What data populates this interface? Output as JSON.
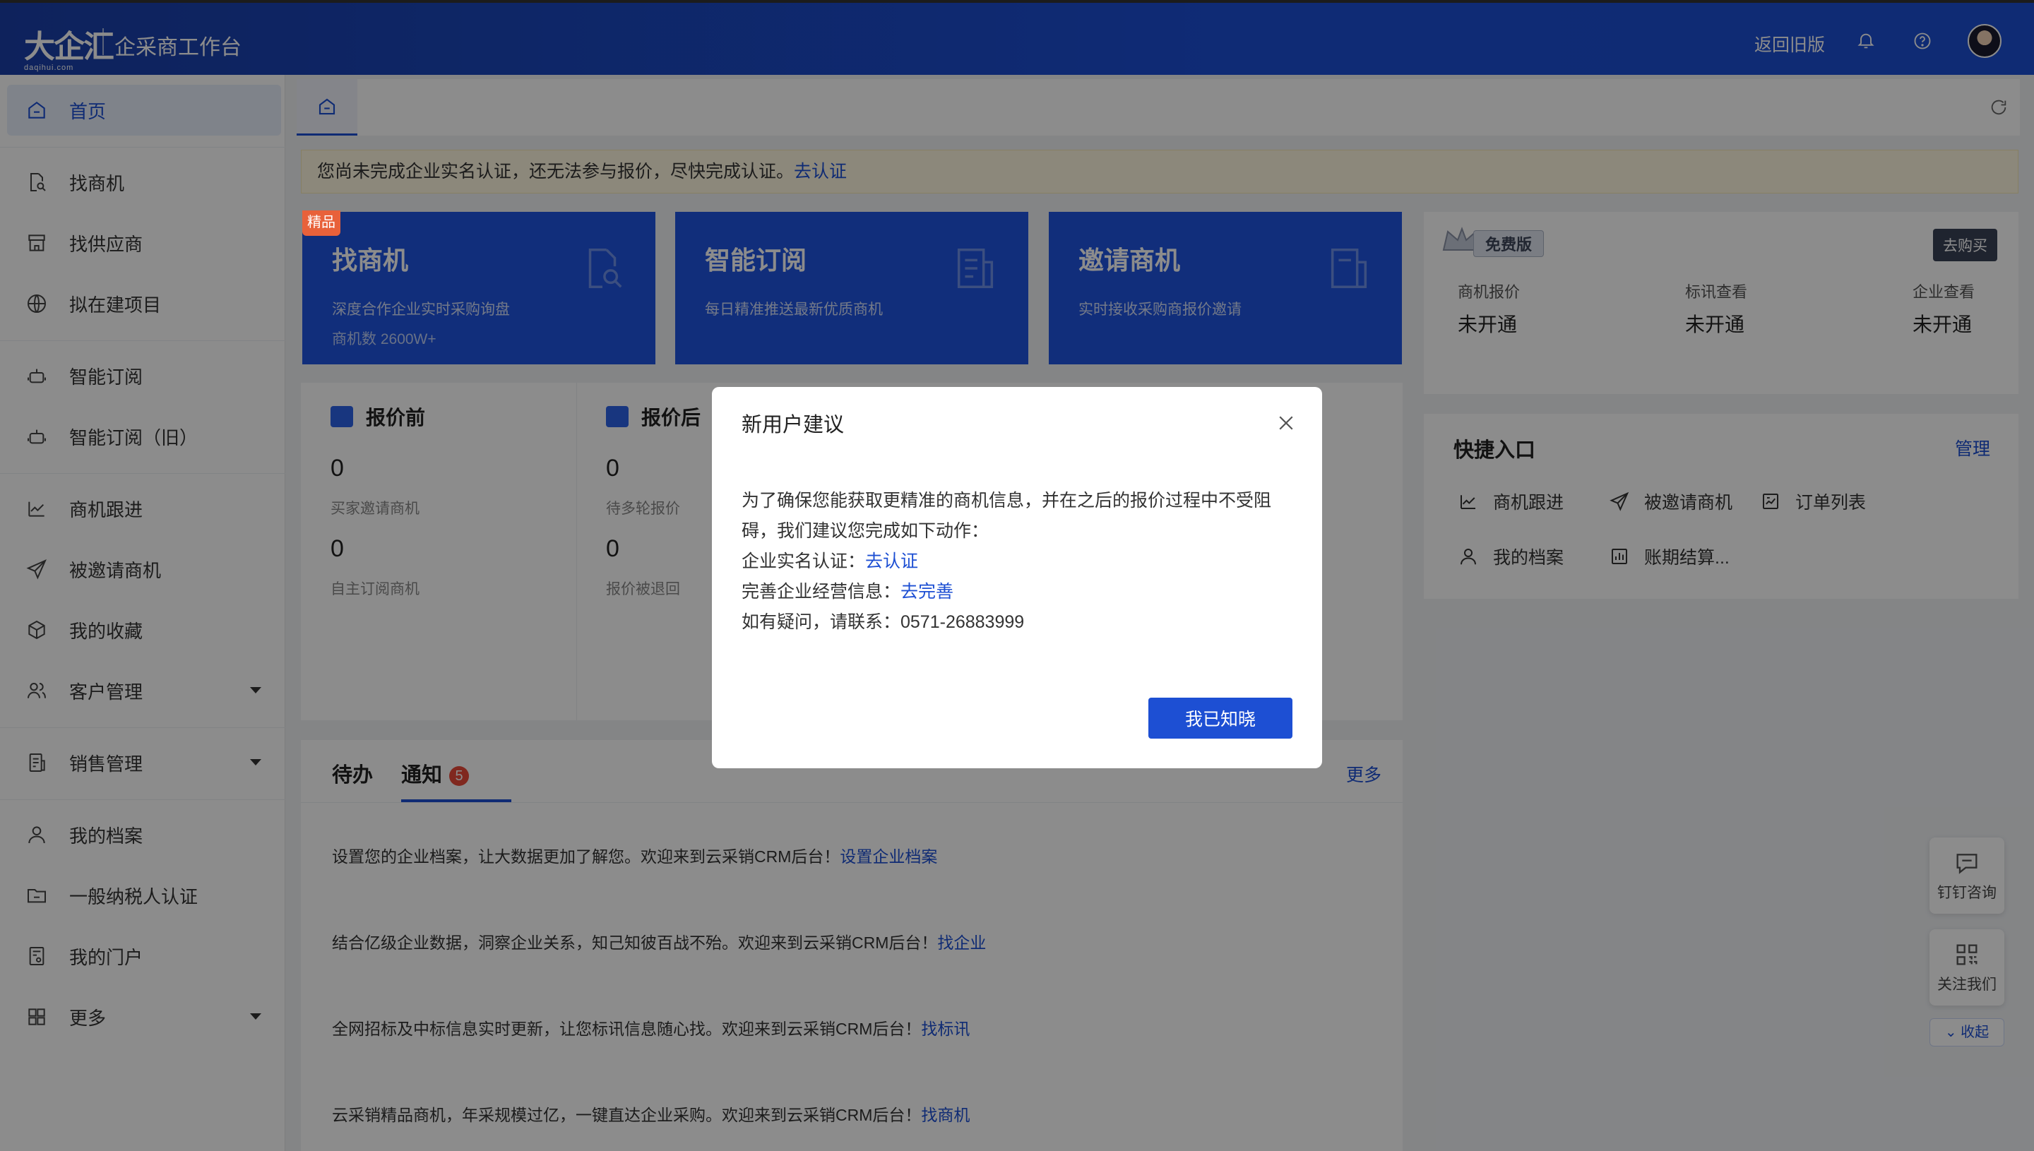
{
  "header": {
    "logo_mark": "大企汇",
    "logo_sub": "daqihui.com",
    "app_title": "企采商工作台",
    "old_version_link": "返回旧版",
    "icons": [
      "bell-icon",
      "help-icon",
      "avatar"
    ]
  },
  "sidebar": {
    "items": [
      {
        "label": "首页",
        "icon": "home-icon",
        "active": true
      },
      {
        "label": "找商机",
        "icon": "search-doc-icon"
      },
      {
        "label": "找供应商",
        "icon": "store-icon"
      },
      {
        "label": "拟在建项目",
        "icon": "globe-icon"
      },
      {
        "label": "智能订阅",
        "icon": "robot-icon"
      },
      {
        "label": "智能订阅（旧）",
        "icon": "robot-icon"
      },
      {
        "label": "商机跟进",
        "icon": "chart-icon"
      },
      {
        "label": "被邀请商机",
        "icon": "send-icon"
      },
      {
        "label": "我的收藏",
        "icon": "box-icon"
      },
      {
        "label": "客户管理",
        "icon": "users-icon",
        "expandable": true
      },
      {
        "label": "销售管理",
        "icon": "ledger-icon",
        "expandable": true
      },
      {
        "label": "我的档案",
        "icon": "user-icon"
      },
      {
        "label": "一般纳税人认证",
        "icon": "folder-icon"
      },
      {
        "label": "我的门户",
        "icon": "portal-icon"
      },
      {
        "label": "更多",
        "icon": "grid-icon",
        "expandable": true
      }
    ]
  },
  "notice": {
    "text": "您尚未完成企业实名认证，还无法参与报价，尽快完成认证。",
    "link": "去认证"
  },
  "feature_cards": [
    {
      "title": "找商机",
      "desc": "深度合作企业实时采购询盘",
      "desc2": "商机数 2600W+",
      "badge": "精品"
    },
    {
      "title": "智能订阅",
      "desc": "每日精准推送最新优质商机"
    },
    {
      "title": "邀请商机",
      "desc": "实时接收采购商报价邀请"
    }
  ],
  "account": {
    "plan": "免费版",
    "buy": "去购买",
    "items": [
      {
        "key": "商机报价",
        "value": "未开通"
      },
      {
        "key": "标讯查看",
        "value": "未开通"
      },
      {
        "key": "企业查看",
        "value": "未开通"
      }
    ]
  },
  "stats": {
    "before": {
      "title": "报价前",
      "a_val": "0",
      "a_lbl": "买家邀请商机",
      "b_val": "0",
      "b_lbl": "自主订阅商机"
    },
    "after": {
      "title": "报价后",
      "a_val": "0",
      "a_lbl": "待多轮报价",
      "b_val": "0",
      "b_lbl": "报价被退回"
    }
  },
  "quick": {
    "title": "快捷入口",
    "manage": "管理",
    "items": [
      {
        "label": "商机跟进",
        "icon": "chart-icon"
      },
      {
        "label": "被邀请商机",
        "icon": "send-icon"
      },
      {
        "label": "订单列表",
        "icon": "order-icon"
      },
      {
        "label": "我的档案",
        "icon": "user-icon"
      },
      {
        "label": "账期结算...",
        "icon": "bar-chart-icon"
      }
    ]
  },
  "todo": {
    "tab1": "待办",
    "tab2": "通知",
    "count": "5",
    "more": "更多",
    "rows": [
      {
        "text": "设置您的企业档案，让大数据更加了解您。欢迎来到云采销CRM后台！",
        "link": "设置企业档案"
      },
      {
        "text": "结合亿级企业数据，洞察企业关系，知己知彼百战不殆。欢迎来到云采销CRM后台！",
        "link": "找企业"
      },
      {
        "text": "全网招标及中标信息实时更新，让您标讯信息随心找。欢迎来到云采销CRM后台！",
        "link": "找标讯"
      },
      {
        "text": "云采销精品商机，年采规模过亿，一键直达企业采购。欢迎来到云采销CRM后台！",
        "link": "找商机"
      }
    ]
  },
  "floating": {
    "dingtalk": "钉钉咨询",
    "follow": "关注我们",
    "collapse": "收起"
  },
  "modal": {
    "title": "新用户建议",
    "line1": "为了确保您能获取更精准的商机信息，并在之后的报价过程中不受阻碍，我们建议您完成如下动作：",
    "verify_label": "企业实名认证：",
    "verify_link": "去认证",
    "info_label": "完善企业经营信息：",
    "info_link": "去完善",
    "contact": "如有疑问，请联系：0571-26883999",
    "ok": "我已知晓"
  },
  "colors": {
    "primary": "#1d4fd3",
    "header_bg": "#1c4fd6",
    "notice_bg": "#fff7e0",
    "badge": "#e8613a"
  }
}
